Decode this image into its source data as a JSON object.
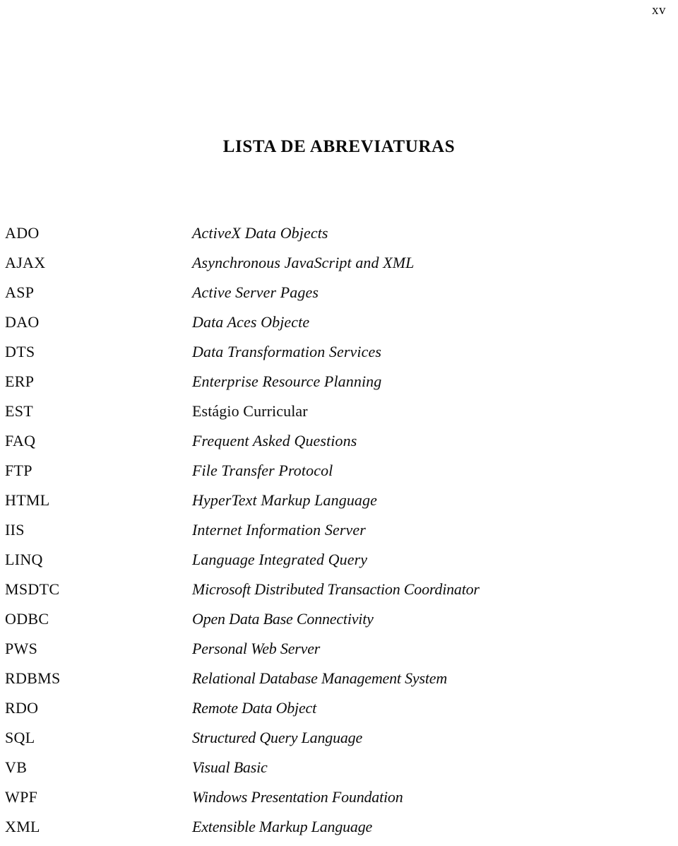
{
  "page": {
    "folio": "xv",
    "title": "LISTA DE ABREVIATURAS"
  },
  "abbreviations": [
    {
      "term": "ADO",
      "definition": "ActiveX Data Objects",
      "style": "italic"
    },
    {
      "term": "AJAX",
      "definition": "Asynchronous JavaScript and XML",
      "style": "italic"
    },
    {
      "term": "ASP",
      "definition": "Active Server Pages",
      "style": "italic"
    },
    {
      "term": "DAO",
      "definition": "Data Aces Objecte",
      "style": "italic"
    },
    {
      "term": "DTS",
      "definition": "Data Transformation Services",
      "style": "italic"
    },
    {
      "term": "ERP",
      "definition": "Enterprise Resource Planning",
      "style": "italic"
    },
    {
      "term": "EST",
      "definition": "Estágio Curricular",
      "style": "upright"
    },
    {
      "term": "FAQ",
      "definition": "Frequent Asked Questions",
      "style": "italic"
    },
    {
      "term": "FTP",
      "definition": "File Transfer Protocol",
      "style": "italic"
    },
    {
      "term": "HTML",
      "definition": "HyperText Markup Language",
      "style": "italic"
    },
    {
      "term": "IIS",
      "definition": "Internet Information Server",
      "style": "italic"
    },
    {
      "term": "LINQ",
      "definition": "Language Integrated Query",
      "style": "italic"
    },
    {
      "term": "MSDTC",
      "definition": "Microsoft Distributed Transaction Coordinator",
      "style": "condensed"
    },
    {
      "term": "ODBC",
      "definition": "Open Data Base Connectivity",
      "style": "condensed"
    },
    {
      "term": "PWS",
      "definition": "Personal Web Server",
      "style": "condensed"
    },
    {
      "term": "RDBMS",
      "definition": "Relational Database Management System",
      "style": "condensed"
    },
    {
      "term": "RDO",
      "definition": "Remote Data Object",
      "style": "condensed"
    },
    {
      "term": "SQL",
      "definition": "Structured Query Language",
      "style": "condensed"
    },
    {
      "term": "VB",
      "definition": "Visual Basic",
      "style": "condensed"
    },
    {
      "term": "WPF",
      "definition": "Windows Presentation Foundation",
      "style": "condensed"
    },
    {
      "term": "XML",
      "definition": "Extensible Markup Language",
      "style": "condensed"
    }
  ]
}
